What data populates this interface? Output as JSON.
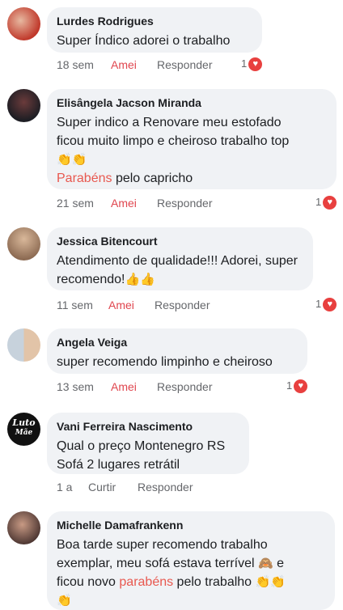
{
  "comments": [
    {
      "name": "Lurdes Rodrigues",
      "text": "Super Índico adorei o trabalho",
      "time": "18 sem",
      "like": "Amei",
      "reply": "Responder",
      "reaction_count": "1"
    },
    {
      "name": "Elisângela Jacson Miranda",
      "text_line1": "Super indico a Renovare meu estofado",
      "text_line2": "ficou muito limpo e cheiroso trabalho top",
      "emoji": "👏👏",
      "highlight": "Parabéns",
      "text_line4": " pelo capricho",
      "time": "21 sem",
      "like": "Amei",
      "reply": "Responder",
      "reaction_count": "1"
    },
    {
      "name": "Jessica Bitencourt",
      "text_line1": "Atendimento de qualidade!!! Adorei, super",
      "text_line2": "recomendo!",
      "emoji": "👍👍",
      "time": "11 sem",
      "like": "Amei",
      "reply": "Responder",
      "reaction_count": "1"
    },
    {
      "name": "Angela Veiga",
      "text": "super recomendo limpinho e cheiroso",
      "time": "13 sem",
      "like": "Amei",
      "reply": "Responder",
      "reaction_count": "1"
    },
    {
      "name": "Vani Ferreira Nascimento",
      "avatar_word": "Luto",
      "avatar_sub": "Mãe",
      "text_line1": "Qual o preço Montenegro RS",
      "text_line2": "Sofá 2 lugares retrátil",
      "time": "1 a",
      "like": "Curtir",
      "reply": "Responder"
    },
    {
      "name": "Michelle Damafrankenn",
      "text_line1": "Boa tarde super recomendo trabalho",
      "text_line2": "exemplar, meu sofá estava terrível",
      "emoji_mid": "🙈",
      "text_line2b": " e",
      "text_line3a": "ficou novo ",
      "highlight": "parabéns",
      "text_line3b": " pelo trabalho ",
      "emoji_end": "👏👏",
      "emoji_last": "👏"
    }
  ],
  "colors": {
    "bubble": "#f0f2f5",
    "loved": "#e0464f",
    "highlight": "#e8584f",
    "meta": "#65676b"
  },
  "icons": {
    "reaction": "heart-icon"
  }
}
